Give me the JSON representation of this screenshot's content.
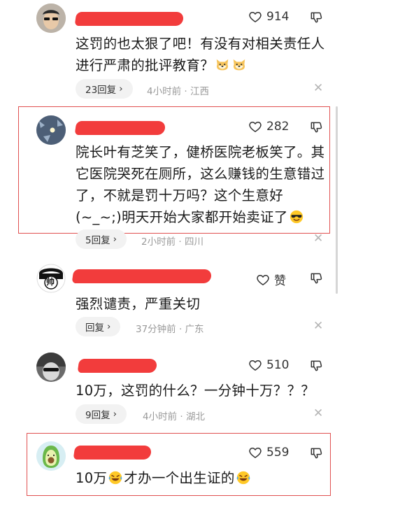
{
  "comments": [
    {
      "likes": "914",
      "text": "这罚的也太狠了吧！有没有对相关责任人进行严肃的批评教育？",
      "reply_label": "23回复",
      "meta": "4小时前 · 江西"
    },
    {
      "likes": "282",
      "text": "院长叶有芝笑了，健桥医院老板笑了。其它医院哭死在厕所，这么赚钱的生意错过了，不就是罚十万吗？这个生意好(~_~;)明天开始大家都开始卖证了",
      "reply_label": "5回复",
      "meta": "2小时前 · 四川"
    },
    {
      "likes": "赞",
      "avatar_text": "帅",
      "text": "强烈谴责，严重关切",
      "reply_label": "回复",
      "meta": "37分钟前 · 广东"
    },
    {
      "likes": "510",
      "text": "10万，这罚的什么？一分钟十万？？？",
      "reply_label": "9回复",
      "meta": "4小时前 · 湖北"
    },
    {
      "likes": "559",
      "text_part1": "10万",
      "text_part2": "才办一个出生证的"
    }
  ],
  "icons": {
    "like": "heart-outline-icon",
    "dislike": "thumbs-down-icon",
    "close": "close-icon",
    "chevron": "chevron-right-icon"
  },
  "colors": {
    "redaction": "#f23c3c",
    "highlight_box": "#e05050",
    "meta_text": "#9a9a9a"
  }
}
